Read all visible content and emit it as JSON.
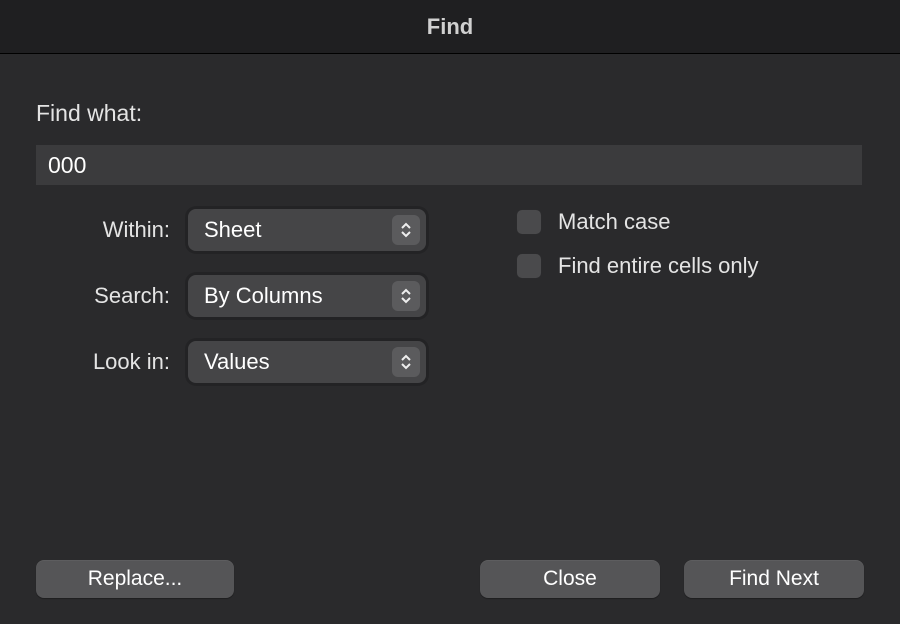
{
  "title": "Find",
  "find": {
    "label": "Find what:",
    "value": "000"
  },
  "selects": {
    "within": {
      "label": "Within:",
      "value": "Sheet"
    },
    "search": {
      "label": "Search:",
      "value": "By Columns"
    },
    "lookin": {
      "label": "Look in:",
      "value": "Values"
    }
  },
  "checks": {
    "match_case": {
      "label": "Match case",
      "checked": false
    },
    "entire_cells": {
      "label": "Find entire cells only",
      "checked": false
    }
  },
  "buttons": {
    "replace": "Replace...",
    "close": "Close",
    "find_next": "Find Next"
  }
}
